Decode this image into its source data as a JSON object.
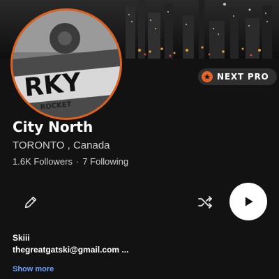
{
  "header": {
    "badge_label": "NEXT PRO",
    "badge_icon": "star-icon"
  },
  "profile": {
    "name": "City North",
    "location": "TORONTO , Canada",
    "followers": "1.6K Followers",
    "separator": "·",
    "following": "7 Following",
    "avatar_text": "RKY",
    "avatar_subtext": "ROCKET"
  },
  "actions": {
    "edit_icon": "pencil-icon",
    "shuffle_icon": "shuffle-icon",
    "play_icon": "play-icon"
  },
  "bio": {
    "line1": "Skiii",
    "line2": "thegreatgatski@gmail.com ...",
    "show_more": "Show more"
  },
  "colors": {
    "background": "#121212",
    "avatar_ring": "#e0601c",
    "badge_accent": "#e4642a",
    "link": "#6aa0ff"
  }
}
